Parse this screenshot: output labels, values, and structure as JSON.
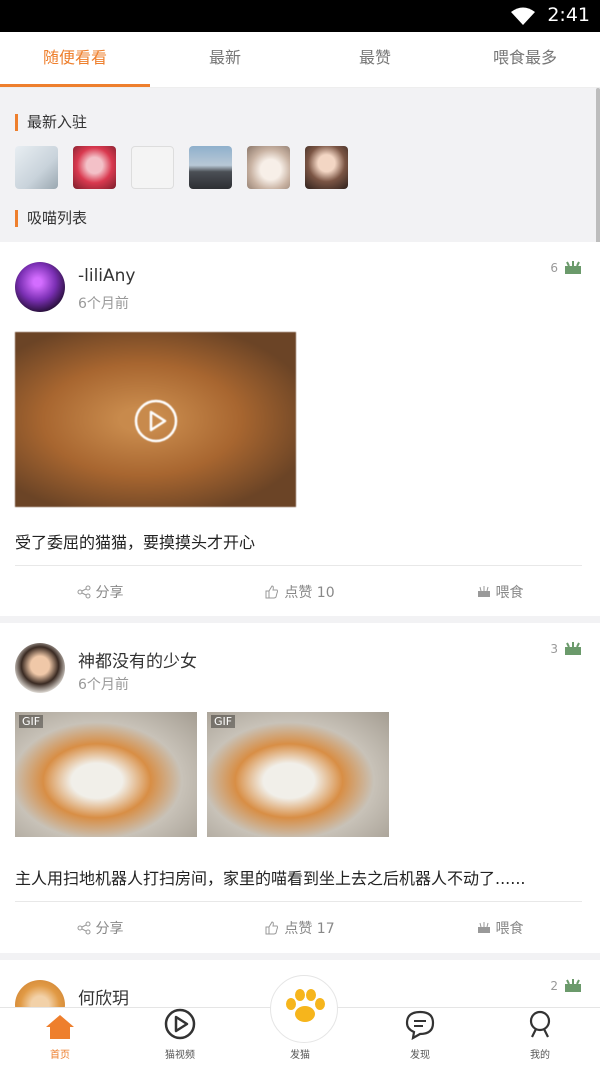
{
  "status_bar": {
    "time": "2:41"
  },
  "top_tabs": [
    {
      "label": "随便看看",
      "active": true
    },
    {
      "label": "最新",
      "active": false
    },
    {
      "label": "最赞",
      "active": false
    },
    {
      "label": "喂食最多",
      "active": false
    }
  ],
  "sections": {
    "newcomers_title": "最新入驻",
    "feed_title": "吸喵列表"
  },
  "posts": [
    {
      "username": "-liliAny",
      "time": "6个月前",
      "food_count": "6",
      "caption": "受了委屈的猫猫，要摸摸头才开心",
      "share_label": "分享",
      "like_label": "点赞 10",
      "feed_label": "喂食"
    },
    {
      "username": "神都没有的少女",
      "time": "6个月前",
      "food_count": "3",
      "gif_badge_1": "GIF",
      "gif_badge_2": "GIF",
      "caption": "主人用扫地机器人打扫房间，家里的喵看到坐上去之后机器人不动了......",
      "share_label": "分享",
      "like_label": "点赞 17",
      "feed_label": "喂食"
    },
    {
      "username": "何欣玥",
      "food_count": "2"
    }
  ],
  "bottom_nav": [
    {
      "label": "首页",
      "icon": "home-icon",
      "active": true
    },
    {
      "label": "猫视频",
      "icon": "video-icon",
      "active": false
    },
    {
      "label": "发猫",
      "icon": "paw-icon",
      "active": false
    },
    {
      "label": "发现",
      "icon": "chat-icon",
      "active": false
    },
    {
      "label": "我的",
      "icon": "user-icon",
      "active": false
    }
  ],
  "colors": {
    "accent": "#ee7f2d",
    "background": "#f2f2f4",
    "card": "#ffffff"
  }
}
